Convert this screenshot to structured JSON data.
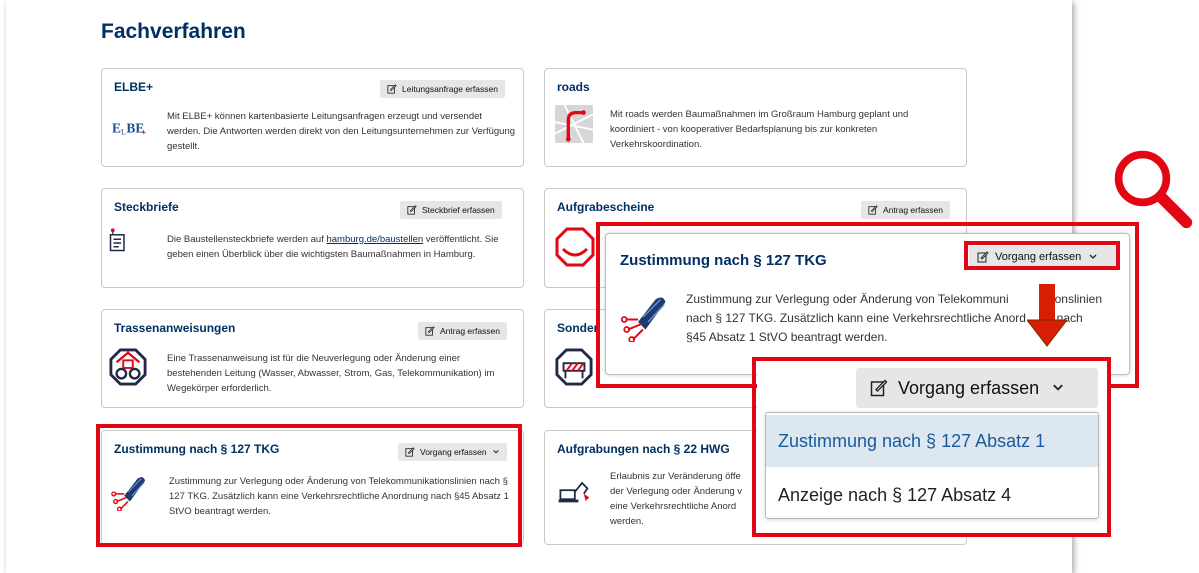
{
  "page": {
    "title": "Fachverfahren"
  },
  "cards": {
    "elbe": {
      "title": "ELBE+",
      "button": "Leitungsanfrage erfassen",
      "description": "Mit ELBE+ können kartenbasierte Leitungsanfragen erzeugt und versendet werden. Die Antworten werden direkt von den Leitungsunternehmen zur Verfügung gestellt.",
      "logo_text": "ELBE+"
    },
    "roads": {
      "title": "roads",
      "description": "Mit roads werden Baumaßnahmen im Großraum Hamburg geplant und koordiniert - von kooperativer Bedarfsplanung bis zur konkreten Verkehrskoordination."
    },
    "steckbriefe": {
      "title": "Steckbriefe",
      "button": "Steckbrief erfassen",
      "desc_before": "Die Baustellensteckbriefe werden auf ",
      "link": "hamburg.de/baustellen",
      "desc_after": " veröffentlicht. Sie geben einen Überblick über die wichtigsten Baumaßnahmen in Hamburg."
    },
    "aufgrabescheine": {
      "title": "Aufgrabescheine",
      "button": "Antrag erfassen"
    },
    "trassen": {
      "title": "Trassenanweisungen",
      "button": "Antrag erfassen",
      "description": "Eine Trassenanweisung ist für die Neuverlegung oder Änderung einer bestehenden Leitung (Wasser, Abwasser, Strom, Gas, Telekommunikation) im Wegekörper erforderlich."
    },
    "sonder": {
      "title": "Sonder"
    },
    "tkg": {
      "title": "Zustimmung nach § 127 TKG",
      "button": "Vorgang erfassen",
      "description": "Zustimmung zur Verlegung oder Änderung von Telekommunikationslinien nach § 127 TKG. Zusätzlich kann eine Verkehrsrechtliche Anordnung nach §45 Absatz 1 StVO beantragt werden."
    },
    "hwg": {
      "title": "Aufgrabungen nach § 22 HWG",
      "desc_lines": [
        "Erlaubnis zur Veränderung öffe",
        "der Verlegung oder Änderung v",
        "eine Verkehrsrechtliche Anord",
        "werden."
      ]
    }
  },
  "zoom": {
    "title": "Zustimmung nach § 127 TKG",
    "button": "Vorgang erfassen",
    "desc_lines": [
      "Zustimmung zur Verlegung oder Änderung von Telekommuni",
      "onslinien",
      "nach § 127 TKG. Zusätzlich kann eine Verkehrsrechtliche Anord",
      "ng nach",
      "§45 Absatz 1 StVO beantragt werden."
    ]
  },
  "dropdown": {
    "button": "Vorgang erfassen",
    "items": [
      "Zustimmung nach § 127 Absatz 1",
      "Anzeige nach § 127 Absatz 4"
    ]
  },
  "colors": {
    "brand": "#003063",
    "highlight": "#e30613",
    "button_bg": "#e6e6e6",
    "dropdown_active_bg": "#dde7f0",
    "dropdown_active_text": "#1a5a9a",
    "arrow": "#d81e05"
  },
  "icons": [
    "edit-icon",
    "chevron-down-icon",
    "magnifier-icon",
    "arrow-down-icon",
    "elbe-logo",
    "roads-logo",
    "document-icon",
    "construction-sign-icon",
    "pipe-icon",
    "road-barrier-icon",
    "fiber-cable-icon",
    "excavator-icon"
  ]
}
